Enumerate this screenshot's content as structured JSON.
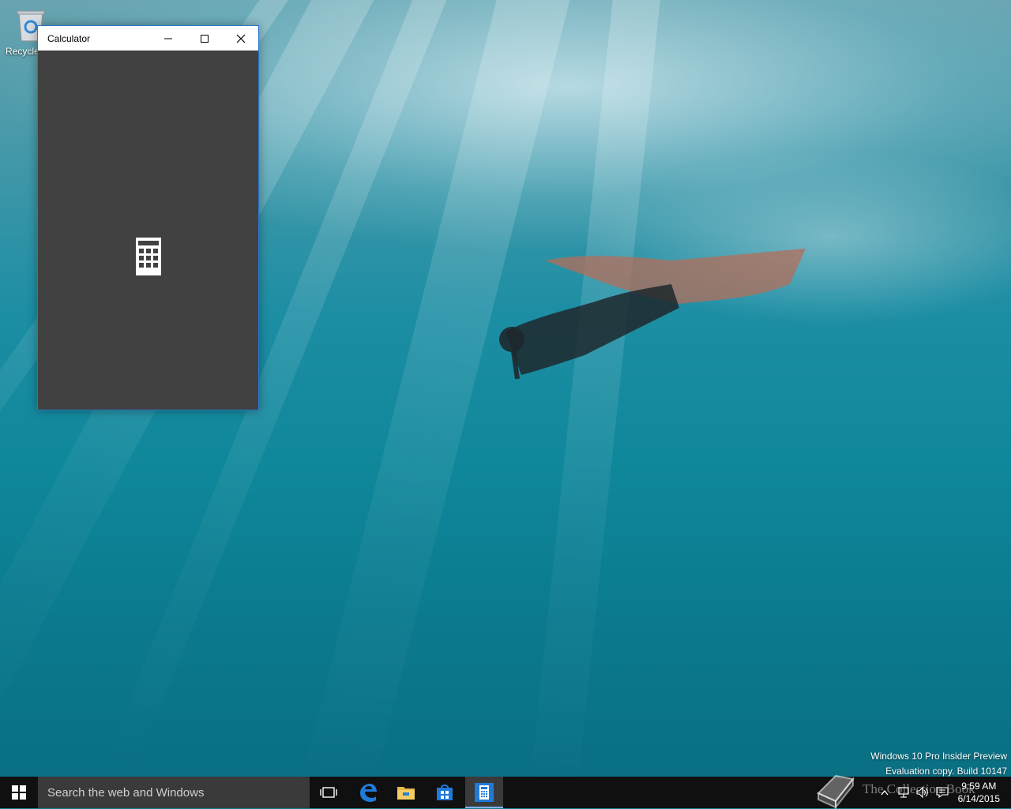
{
  "desktop": {
    "recycle_bin_label": "Recycle"
  },
  "window": {
    "title": "Calculator",
    "minimize_icon": "minimize-icon",
    "maximize_icon": "maximize-icon",
    "close_icon": "close-icon",
    "splash_icon": "calculator-icon"
  },
  "watermark": {
    "line1": "Windows 10 Pro Insider Preview",
    "line2": "Evaluation copy. Build 10147"
  },
  "taskbar": {
    "search_placeholder": "Search the web and Windows",
    "apps": [
      "task-view-icon",
      "edge-icon",
      "file-explorer-icon",
      "store-icon",
      "calculator-icon"
    ],
    "active_app": "Calculator",
    "clock_time": "9:59 AM",
    "clock_date": "6/14/2015",
    "overlay_text": "The Collection Book"
  },
  "colors": {
    "accent": "#2b78c8",
    "taskbar": "#101010",
    "window_body": "#414141"
  }
}
